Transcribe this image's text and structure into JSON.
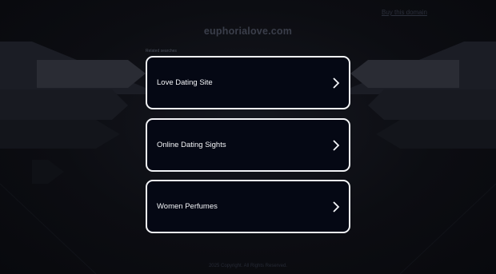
{
  "header": {
    "buy_link": "Buy this domain",
    "domain": "euphorialove.com"
  },
  "related": {
    "label": "Related searches",
    "items": [
      {
        "label": "Love Dating Site",
        "icon": "chevron-right-icon"
      },
      {
        "label": "Online Dating Sights",
        "icon": "chevron-right-icon"
      },
      {
        "label": "Women Perfumes",
        "icon": "chevron-right-icon"
      }
    ]
  },
  "footer": {
    "text": "2025 Copyright. All Rights Reserved."
  },
  "colors": {
    "background": "#0c0d12",
    "card_bg": "#050814",
    "card_border": "#f2f3f6",
    "text": "#f4f5f8"
  }
}
